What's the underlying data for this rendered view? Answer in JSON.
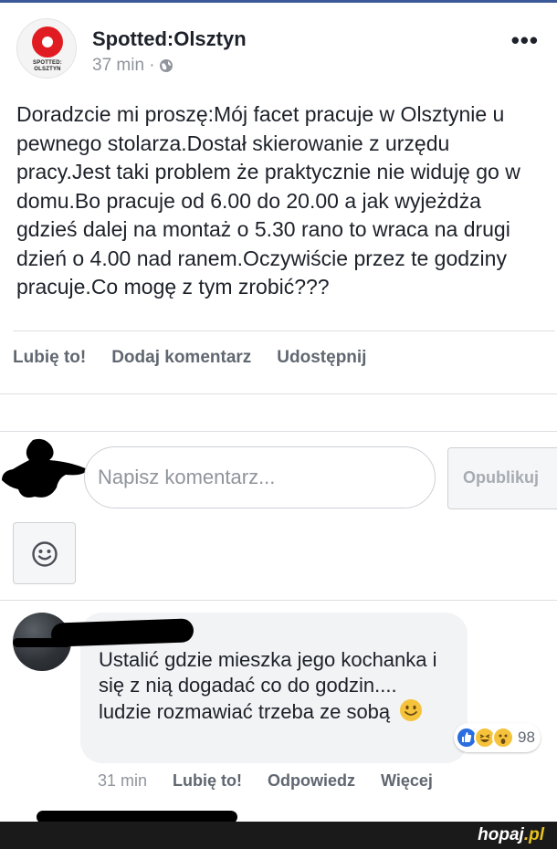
{
  "post": {
    "page_name": "Spotted:Olsztyn",
    "logo_text_line1": "SPOTTED:",
    "logo_text_line2": "OLSZTYN",
    "time": "37 min ·",
    "body": "Doradzcie mi proszę:Mój facet pracuje w Olsztynie u pewnego stolarza.Dostał skierowanie z urzędu pracy.Jest taki problem że praktycznie nie widuję go w domu.Bo pracuje od 6.00 do 20.00 a jak wyjeżdża gdzieś dalej na montaż o 5.30 rano to wraca na drugi dzień o 4.00 nad ranem.Oczywiście przez te godziny pracuje.Co mogę z tym zrobić???",
    "more_icon": "more-options-icon",
    "privacy_icon": "globe-icon"
  },
  "actions": {
    "like": "Lubię to!",
    "comment": "Dodaj komentarz",
    "share": "Udostępnij"
  },
  "composer": {
    "placeholder": "Napisz komentarz...",
    "publish": "Opublikuj",
    "emoji_icon": "smiley-icon"
  },
  "comment": {
    "text": "Ustalić gdzie mieszka jego kochanka i się z nią dogadać co do godzin.... ludzie rozmawiać trzeba ze sobą",
    "reaction_count": "98",
    "reactions": [
      "like",
      "laugh",
      "wow"
    ],
    "time": "31 min",
    "like": "Lubię to!",
    "reply": "Odpowiedz",
    "more": "Więcej"
  },
  "footer": {
    "watermark_main": "hopaj",
    "watermark_tld": ".pl"
  },
  "colors": {
    "accent": "#3b5998",
    "logo_red": "#e11b22",
    "like_blue": "#2a6de0",
    "emoji_yellow": "#f5c33b"
  }
}
